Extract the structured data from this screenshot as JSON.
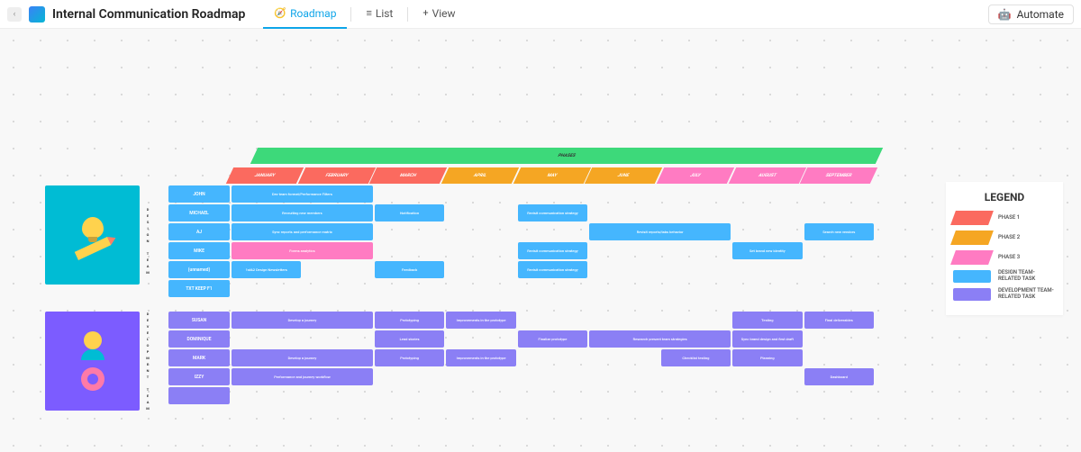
{
  "header": {
    "page_title": "Internal Communication Roadmap",
    "tabs": [
      {
        "label": "Roadmap",
        "icon": "📊"
      },
      {
        "label": "List",
        "icon": "≡"
      },
      {
        "label": "View",
        "icon": "+"
      }
    ],
    "automate_label": "Automate"
  },
  "legend": {
    "title": "LEGEND",
    "items": [
      {
        "label": "PHASE 1",
        "color": "#fb6a5f"
      },
      {
        "label": "PHASE 2",
        "color": "#f5a623"
      },
      {
        "label": "PHASE 3",
        "color": "#ff7bc2"
      },
      {
        "label": "DESIGN TEAM-RELATED TASK",
        "color": "#45b6fe"
      },
      {
        "label": "DEVELOPMENT TEAM-RELATED TASK",
        "color": "#8b7ff5"
      }
    ]
  },
  "months": [
    "JANUARY",
    "FEBRUARY",
    "MARCH",
    "APRIL",
    "MAY",
    "JUNE",
    "JULY",
    "AUGUST",
    "SEPTEMBER"
  ],
  "phases_label": "PHASES",
  "teams": [
    {
      "name": "DESIGN TEAM",
      "color": "#45b6fe",
      "rows": [
        {
          "name": "JOHN",
          "tasks": [
            {
              "start": 0,
              "span": 2,
              "label": "Dev team format/Performance Filters",
              "color": "#45b6fe"
            }
          ]
        },
        {
          "name": "MICHAEL",
          "tasks": [
            {
              "start": 0,
              "span": 2,
              "label": "Recruiting new members",
              "color": "#45b6fe"
            },
            {
              "start": 2,
              "span": 1,
              "label": "Notification",
              "color": "#45b6fe"
            },
            {
              "start": 4,
              "span": 1,
              "label": "Revisit communication strategy",
              "color": "#45b6fe"
            }
          ]
        },
        {
          "name": "AJ",
          "tasks": [
            {
              "start": 0,
              "span": 2,
              "label": "Sync reports and performance matrix",
              "color": "#45b6fe"
            },
            {
              "start": 5,
              "span": 2,
              "label": "Revisit reports/tabs behavior",
              "color": "#45b6fe"
            },
            {
              "start": 8,
              "span": 1,
              "label": "Search new vendors",
              "color": "#45b6fe"
            }
          ]
        },
        {
          "name": "MIKE",
          "tasks": [
            {
              "start": 0,
              "span": 2,
              "label": "Forms analytics",
              "color": "#ff7bc2"
            },
            {
              "start": 4,
              "span": 1,
              "label": "Revisit communication strategy",
              "color": "#45b6fe"
            },
            {
              "start": 7,
              "span": 1,
              "label": "Set brand new identity",
              "color": "#45b6fe"
            }
          ]
        },
        {
          "name": "(unnamed)",
          "tasks": [
            {
              "start": 0,
              "span": 1,
              "label": "1st&2 Design Newsletters",
              "color": "#45b6fe"
            },
            {
              "start": 2,
              "span": 1,
              "label": "Feedback",
              "color": "#45b6fe"
            },
            {
              "start": 4,
              "span": 1,
              "label": "Revisit communication strategy",
              "color": "#45b6fe"
            }
          ]
        },
        {
          "name": "TXT KEEP F1",
          "tasks": []
        }
      ]
    },
    {
      "name": "DEVELOPMENT TEAM",
      "color": "#8b7ff5",
      "rows": [
        {
          "name": "SUSAN",
          "tasks": [
            {
              "start": 0,
              "span": 2,
              "label": "Develop a journey",
              "color": "#8b7ff5"
            },
            {
              "start": 2,
              "span": 1,
              "label": "Prototyping",
              "color": "#8b7ff5"
            },
            {
              "start": 3,
              "span": 1,
              "label": "Improvements in the prototype",
              "color": "#8b7ff5"
            },
            {
              "start": 7,
              "span": 1,
              "label": "Testing",
              "color": "#8b7ff5"
            },
            {
              "start": 8,
              "span": 1,
              "label": "Final deliverables",
              "color": "#8b7ff5"
            }
          ]
        },
        {
          "name": "DOMINIQUE",
          "tasks": [
            {
              "start": 2,
              "span": 1,
              "label": "Lead stories",
              "color": "#8b7ff5"
            },
            {
              "start": 4,
              "span": 1,
              "label": "Finalize prototype",
              "color": "#8b7ff5"
            },
            {
              "start": 5,
              "span": 2,
              "label": "Research present team strategies",
              "color": "#8b7ff5"
            },
            {
              "start": 7,
              "span": 1,
              "label": "Sync brand design and first draft",
              "color": "#8b7ff5"
            }
          ]
        },
        {
          "name": "MARK",
          "tasks": [
            {
              "start": 0,
              "span": 2,
              "label": "Develop a journey",
              "color": "#8b7ff5"
            },
            {
              "start": 2,
              "span": 1,
              "label": "Prototyping",
              "color": "#8b7ff5"
            },
            {
              "start": 3,
              "span": 1,
              "label": "Improvements in the prototype",
              "color": "#8b7ff5"
            },
            {
              "start": 6,
              "span": 1,
              "label": "Checklist testing",
              "color": "#8b7ff5"
            },
            {
              "start": 7,
              "span": 1,
              "label": "Planning",
              "color": "#8b7ff5"
            }
          ]
        },
        {
          "name": "IZZY",
          "tasks": [
            {
              "start": 0,
              "span": 2,
              "label": "Performance and journey workflow",
              "color": "#8b7ff5"
            },
            {
              "start": 8,
              "span": 1,
              "label": "Dashboard",
              "color": "#8b7ff5"
            }
          ]
        },
        {
          "name": "",
          "tasks": []
        }
      ]
    }
  ],
  "chart_data": {
    "type": "table",
    "title": "Internal Communication Roadmap",
    "x": [
      "JANUARY",
      "FEBRUARY",
      "MARCH",
      "APRIL",
      "MAY",
      "JUNE",
      "JULY",
      "AUGUST",
      "SEPTEMBER"
    ],
    "phases": [
      {
        "name": "PHASE 1",
        "color": "#fb6a5f",
        "months": [
          "JANUARY",
          "FEBRUARY",
          "MARCH"
        ]
      },
      {
        "name": "PHASE 2",
        "color": "#f5a623",
        "months": [
          "APRIL",
          "MAY",
          "JUNE"
        ]
      },
      {
        "name": "PHASE 3",
        "color": "#ff7bc2",
        "months": [
          "JULY",
          "AUGUST",
          "SEPTEMBER"
        ]
      }
    ],
    "series": [
      {
        "team": "DESIGN TEAM",
        "person": "JOHN",
        "task": "Dev team format/Performance Filters",
        "start": "JANUARY",
        "end": "FEBRUARY"
      },
      {
        "team": "DESIGN TEAM",
        "person": "MICHAEL",
        "task": "Recruiting new members",
        "start": "JANUARY",
        "end": "FEBRUARY"
      },
      {
        "team": "DESIGN TEAM",
        "person": "MICHAEL",
        "task": "Notification",
        "start": "MARCH",
        "end": "MARCH"
      },
      {
        "team": "DESIGN TEAM",
        "person": "MICHAEL",
        "task": "Revisit communication strategy",
        "start": "MAY",
        "end": "MAY"
      },
      {
        "team": "DESIGN TEAM",
        "person": "AJ",
        "task": "Sync reports and performance matrix",
        "start": "JANUARY",
        "end": "FEBRUARY"
      },
      {
        "team": "DESIGN TEAM",
        "person": "AJ",
        "task": "Revisit reports/tabs behavior",
        "start": "JUNE",
        "end": "JULY"
      },
      {
        "team": "DESIGN TEAM",
        "person": "AJ",
        "task": "Search new vendors",
        "start": "SEPTEMBER",
        "end": "SEPTEMBER"
      },
      {
        "team": "DESIGN TEAM",
        "person": "MIKE",
        "task": "Forms analytics",
        "start": "JANUARY",
        "end": "FEBRUARY"
      },
      {
        "team": "DESIGN TEAM",
        "person": "MIKE",
        "task": "Revisit communication strategy",
        "start": "MAY",
        "end": "MAY"
      },
      {
        "team": "DESIGN TEAM",
        "person": "MIKE",
        "task": "Set brand new identity",
        "start": "AUGUST",
        "end": "AUGUST"
      },
      {
        "team": "DESIGN TEAM",
        "person": "",
        "task": "1st&2 Design Newsletters",
        "start": "JANUARY",
        "end": "JANUARY"
      },
      {
        "team": "DESIGN TEAM",
        "person": "",
        "task": "Feedback",
        "start": "MARCH",
        "end": "MARCH"
      },
      {
        "team": "DESIGN TEAM",
        "person": "",
        "task": "Revisit communication strategy",
        "start": "MAY",
        "end": "MAY"
      },
      {
        "team": "DEVELOPMENT TEAM",
        "person": "SUSAN",
        "task": "Develop a journey",
        "start": "JANUARY",
        "end": "FEBRUARY"
      },
      {
        "team": "DEVELOPMENT TEAM",
        "person": "SUSAN",
        "task": "Prototyping",
        "start": "MARCH",
        "end": "MARCH"
      },
      {
        "team": "DEVELOPMENT TEAM",
        "person": "SUSAN",
        "task": "Improvements in the prototype",
        "start": "APRIL",
        "end": "APRIL"
      },
      {
        "team": "DEVELOPMENT TEAM",
        "person": "SUSAN",
        "task": "Testing",
        "start": "AUGUST",
        "end": "AUGUST"
      },
      {
        "team": "DEVELOPMENT TEAM",
        "person": "SUSAN",
        "task": "Final deliverables",
        "start": "SEPTEMBER",
        "end": "SEPTEMBER"
      },
      {
        "team": "DEVELOPMENT TEAM",
        "person": "DOMINIQUE",
        "task": "Lead stories",
        "start": "MARCH",
        "end": "MARCH"
      },
      {
        "team": "DEVELOPMENT TEAM",
        "person": "DOMINIQUE",
        "task": "Finalize prototype",
        "start": "MAY",
        "end": "MAY"
      },
      {
        "team": "DEVELOPMENT TEAM",
        "person": "DOMINIQUE",
        "task": "Research present team strategies",
        "start": "JUNE",
        "end": "JULY"
      },
      {
        "team": "DEVELOPMENT TEAM",
        "person": "DOMINIQUE",
        "task": "Sync brand design and first draft",
        "start": "AUGUST",
        "end": "AUGUST"
      },
      {
        "team": "DEVELOPMENT TEAM",
        "person": "MARK",
        "task": "Develop a journey",
        "start": "JANUARY",
        "end": "FEBRUARY"
      },
      {
        "team": "DEVELOPMENT TEAM",
        "person": "MARK",
        "task": "Prototyping",
        "start": "MARCH",
        "end": "MARCH"
      },
      {
        "team": "DEVELOPMENT TEAM",
        "person": "MARK",
        "task": "Improvements in the prototype",
        "start": "APRIL",
        "end": "APRIL"
      },
      {
        "team": "DEVELOPMENT TEAM",
        "person": "MARK",
        "task": "Checklist testing",
        "start": "JULY",
        "end": "JULY"
      },
      {
        "team": "DEVELOPMENT TEAM",
        "person": "MARK",
        "task": "Planning",
        "start": "AUGUST",
        "end": "AUGUST"
      },
      {
        "team": "DEVELOPMENT TEAM",
        "person": "IZZY",
        "task": "Performance and journey workflow",
        "start": "JANUARY",
        "end": "FEBRUARY"
      },
      {
        "team": "DEVELOPMENT TEAM",
        "person": "IZZY",
        "task": "Dashboard",
        "start": "SEPTEMBER",
        "end": "SEPTEMBER"
      }
    ]
  }
}
